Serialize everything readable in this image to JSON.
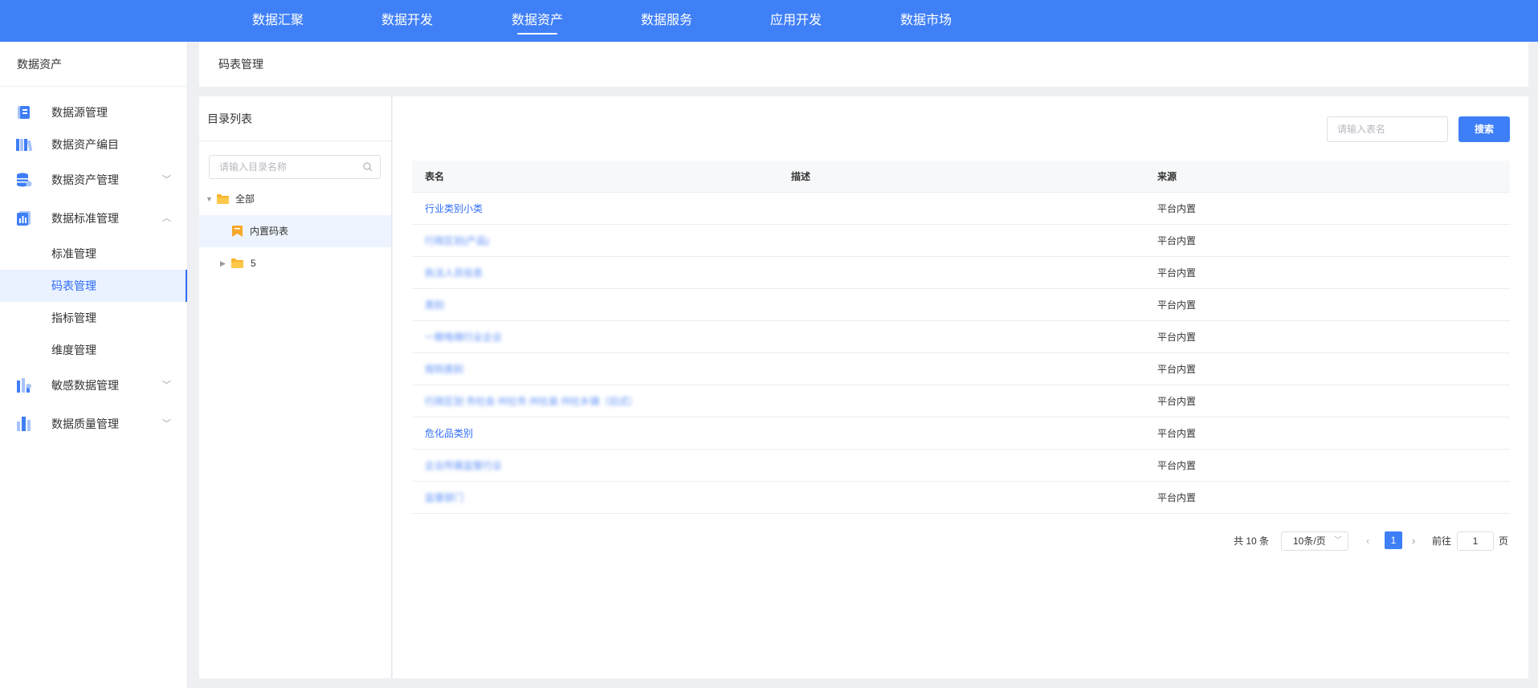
{
  "topnav": {
    "items": [
      "数据汇聚",
      "数据开发",
      "数据资产",
      "数据服务",
      "应用开发",
      "数据市场"
    ],
    "active": "数据资产"
  },
  "sidebar": {
    "title": "数据资产",
    "items": [
      {
        "label": "数据源管理",
        "icon": "datasource-icon"
      },
      {
        "label": "数据资产编目",
        "icon": "catalog-icon"
      },
      {
        "label": "数据资产管理",
        "icon": "database-icon",
        "chevron": "down"
      },
      {
        "label": "数据标准管理",
        "icon": "standard-icon",
        "chevron": "up"
      },
      {
        "label": "敏感数据管理",
        "icon": "sensitive-icon",
        "chevron": "down"
      },
      {
        "label": "数据质量管理",
        "icon": "quality-icon",
        "chevron": "down"
      }
    ],
    "sub_items": [
      "标准管理",
      "码表管理",
      "指标管理",
      "维度管理"
    ],
    "active_sub": "码表管理"
  },
  "breadcrumb": "码表管理",
  "directory": {
    "title": "目录列表",
    "search_placeholder": "请输入目录名称",
    "tree": [
      {
        "label": "全部",
        "level": 0,
        "expanded": true
      },
      {
        "label": "内置码表",
        "level": 1,
        "selected": true
      },
      {
        "label": "5",
        "level": 1,
        "expanded": false
      }
    ]
  },
  "search": {
    "placeholder": "请输入表名",
    "button": "搜索"
  },
  "table": {
    "headers": [
      "表名",
      "描述",
      "来源"
    ],
    "rows": [
      {
        "name": "行业类别小类",
        "desc": "",
        "source": "平台内置",
        "blurred": false
      },
      {
        "name": "行政区划(产品)",
        "desc": "",
        "source": "平台内置",
        "blurred": true
      },
      {
        "name": "执法人员信息",
        "desc": "",
        "source": "平台内置",
        "blurred": true
      },
      {
        "name": "类别",
        "desc": "",
        "source": "平台内置",
        "blurred": true
      },
      {
        "name": "一期电梯行业企业",
        "desc": "",
        "source": "平台内置",
        "blurred": true
      },
      {
        "name": "规则类别",
        "desc": "",
        "source": "平台内置",
        "blurred": true
      },
      {
        "name": "行政区划 市社会 州社市 州社县 州社乡镇（旧式）",
        "desc": "",
        "source": "平台内置",
        "blurred": true
      },
      {
        "name": "危化品类别",
        "desc": "",
        "source": "平台内置",
        "blurred": false
      },
      {
        "name": "企业所属监管行业",
        "desc": "",
        "source": "平台内置",
        "blurred": true
      },
      {
        "name": "监督部门",
        "desc": "",
        "source": "平台内置",
        "blurred": true
      }
    ]
  },
  "pagination": {
    "total_text": "共 10 条",
    "page_size": "10条/页",
    "current_page": "1",
    "goto_label": "前往",
    "goto_value": "1",
    "page_suffix": "页"
  },
  "colors": {
    "primary": "#4080f7",
    "link": "#2f6ef5",
    "folder": "#f7b32b"
  }
}
